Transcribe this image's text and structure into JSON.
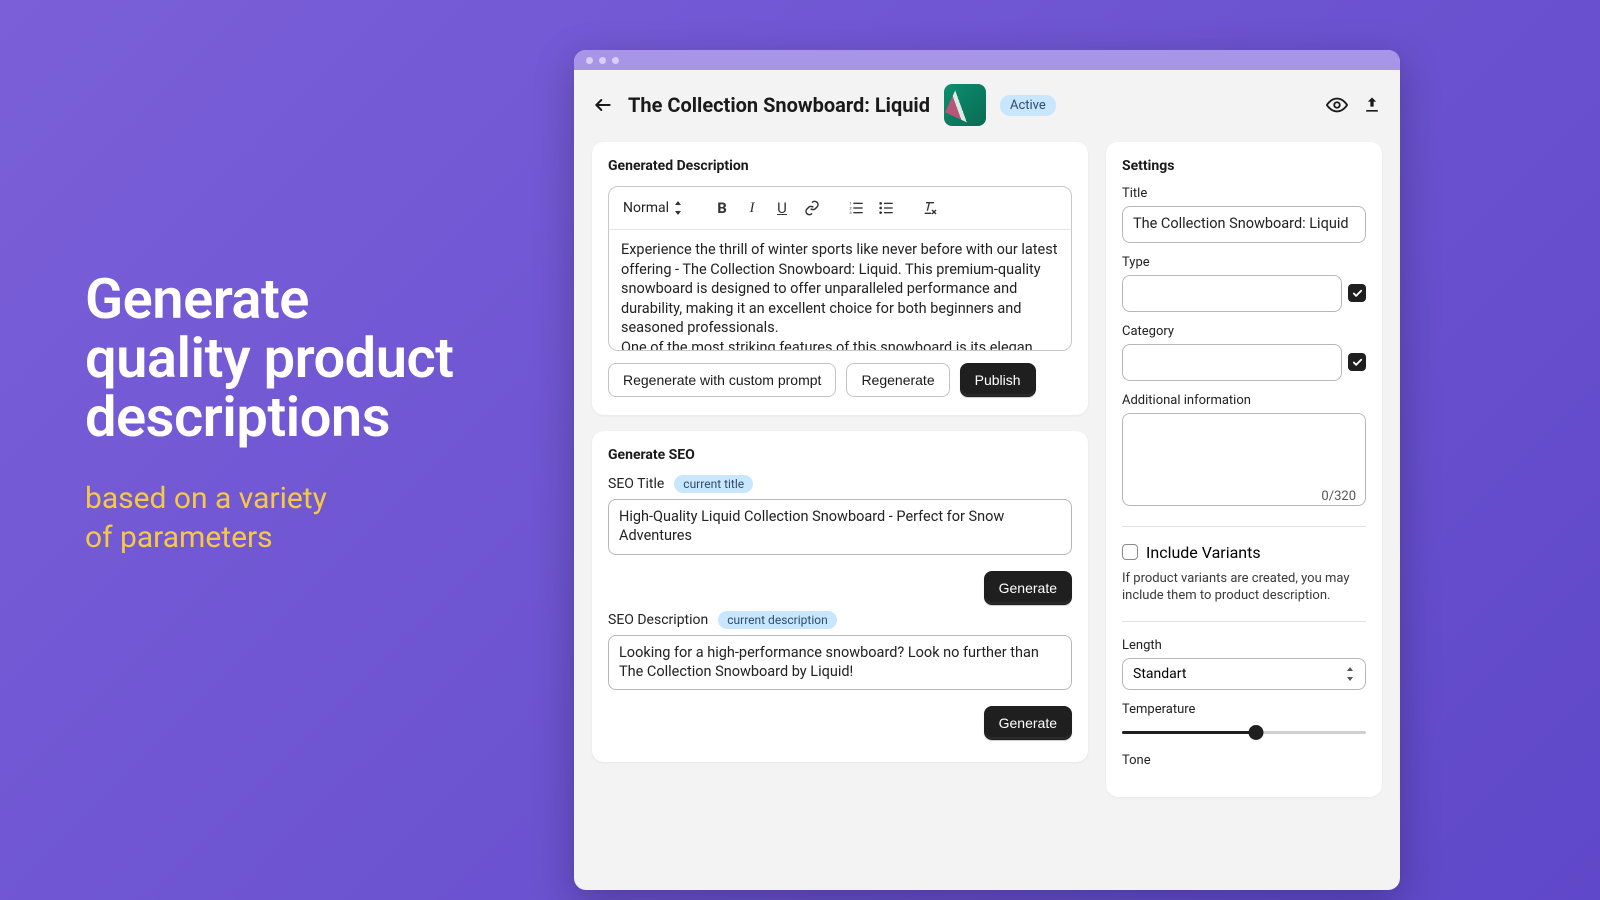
{
  "marketing": {
    "headline_l1": "Generate",
    "headline_l2": "quality product",
    "headline_l3": "descriptions",
    "sub_l1": "based on a variety",
    "sub_l2": "of parameters"
  },
  "header": {
    "title": "The Collection Snowboard: Liquid",
    "status": "Active"
  },
  "description_card": {
    "title": "Generated Description",
    "format_selector": "Normal",
    "body": "Experience the thrill of winter sports like never before with our latest offering - The Collection Snowboard: Liquid. This premium-quality snowboard is designed to offer unparalleled performance and durability, making it an excellent choice for both beginners and seasoned professionals.\nOne of the most striking features of this snowboard is its elegan…",
    "btn_regen_prompt": "Regenerate with custom prompt",
    "btn_regen": "Regenerate",
    "btn_publish": "Publish"
  },
  "seo_card": {
    "title": "Generate SEO",
    "seo_title_label": "SEO Title",
    "seo_title_chip": "current title",
    "seo_title_value": "High-Quality Liquid Collection Snowboard - Perfect for Snow Adventures",
    "seo_desc_label": "SEO Description",
    "seo_desc_chip": "current description",
    "seo_desc_value": "Looking for a high-performance snowboard? Look no further than The Collection Snowboard by Liquid!",
    "btn_generate": "Generate"
  },
  "settings": {
    "title": "Settings",
    "title_label": "Title",
    "title_value": "The Collection Snowboard: Liquid",
    "type_label": "Type",
    "type_value": "",
    "category_label": "Category",
    "category_value": "",
    "additional_label": "Additional information",
    "additional_value": "",
    "char_counter": "0/320",
    "variants_label": "Include Variants",
    "variants_hint": "If product variants are created, you may include them to product description.",
    "length_label": "Length",
    "length_value": "Standart",
    "temperature_label": "Temperature",
    "temperature_pct": 55,
    "tone_label": "Tone"
  }
}
